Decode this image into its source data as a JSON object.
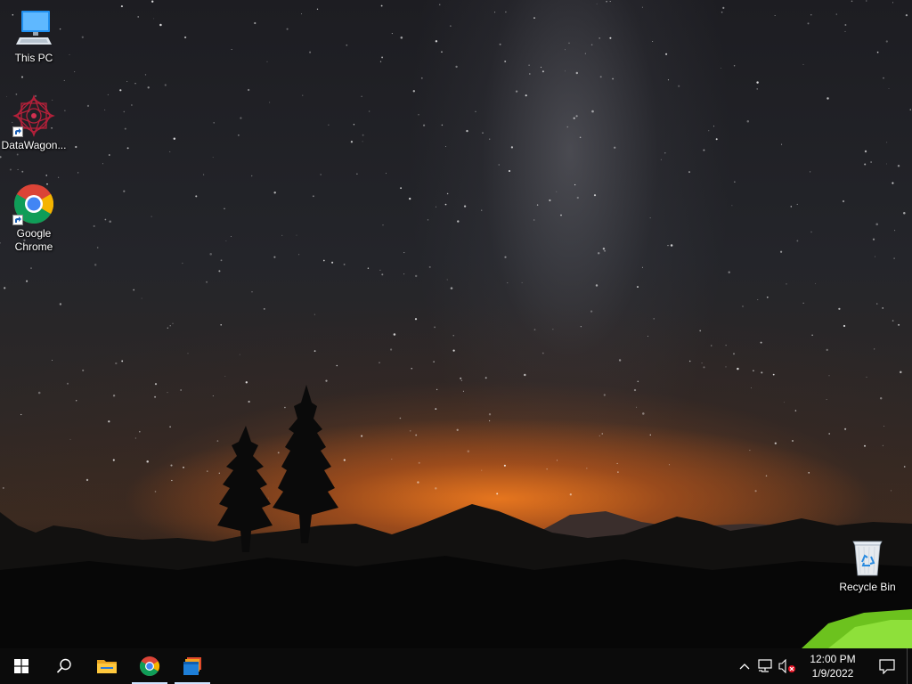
{
  "desktop": {
    "icons": [
      {
        "label": "This PC",
        "icon": "this-pc-icon"
      },
      {
        "label": "DataWagon...",
        "icon": "datawagon-icon"
      },
      {
        "label": "Google Chrome",
        "icon": "chrome-icon"
      },
      {
        "label": "Recycle Bin",
        "icon": "recycle-bin-icon"
      }
    ]
  },
  "taskbar": {
    "buttons": [
      {
        "name": "start",
        "icon": "windows-logo-icon"
      },
      {
        "name": "search",
        "icon": "search-icon"
      },
      {
        "name": "file-explorer",
        "icon": "file-explorer-icon"
      },
      {
        "name": "google-chrome",
        "icon": "chrome-icon"
      },
      {
        "name": "datawagon-app",
        "icon": "app-window-icon"
      }
    ],
    "tray": {
      "icons": [
        "chevron-up-icon",
        "network-disconnected-icon",
        "volume-muted-icon"
      ],
      "time": "12:00 PM",
      "date": "1/9/2022"
    }
  },
  "colors": {
    "taskbar": "#0b0b0b",
    "accent": "#1e90ff",
    "chrome_red": "#db4437",
    "chrome_green": "#0f9d58",
    "chrome_yellow": "#f4b400",
    "chrome_blue": "#4285f4"
  }
}
